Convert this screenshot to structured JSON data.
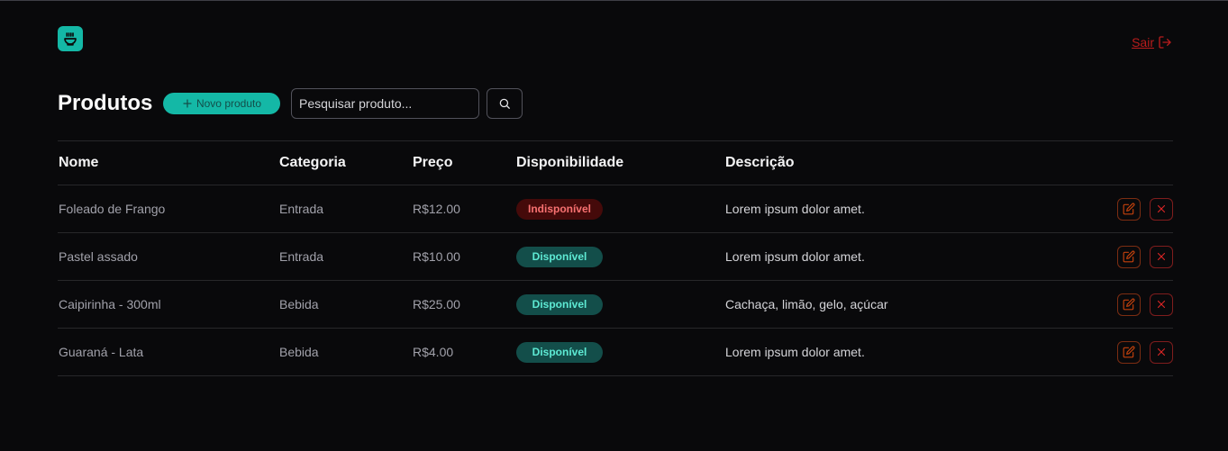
{
  "header": {
    "logo_icon": "bowl-icon",
    "logout_label": "Sair",
    "logout_icon": "log-out-icon"
  },
  "toolbar": {
    "title": "Produtos",
    "new_product_label": "Novo produto",
    "search_placeholder": "Pesquisar produto...",
    "search_icon": "search-icon"
  },
  "table": {
    "columns": [
      "Nome",
      "Categoria",
      "Preço",
      "Disponibilidade",
      "Descrição"
    ],
    "rows": [
      {
        "name": "Foleado de Frango",
        "category": "Entrada",
        "price": "R$12.00",
        "availability": "Indisponível",
        "available": false,
        "description": "Lorem ipsum dolor amet."
      },
      {
        "name": "Pastel assado",
        "category": "Entrada",
        "price": "R$10.00",
        "availability": "Disponível",
        "available": true,
        "description": "Lorem ipsum dolor amet."
      },
      {
        "name": "Caipirinha - 300ml",
        "category": "Bebida",
        "price": "R$25.00",
        "availability": "Disponível",
        "available": true,
        "description": "Cachaça, limão, gelo, açúcar"
      },
      {
        "name": "Guaraná - Lata",
        "category": "Bebida",
        "price": "R$4.00",
        "availability": "Disponível",
        "available": true,
        "description": "Lorem ipsum dolor amet."
      }
    ]
  },
  "colors": {
    "accent": "#14b8a6",
    "danger": "#b91c1c",
    "background": "#09090b"
  }
}
